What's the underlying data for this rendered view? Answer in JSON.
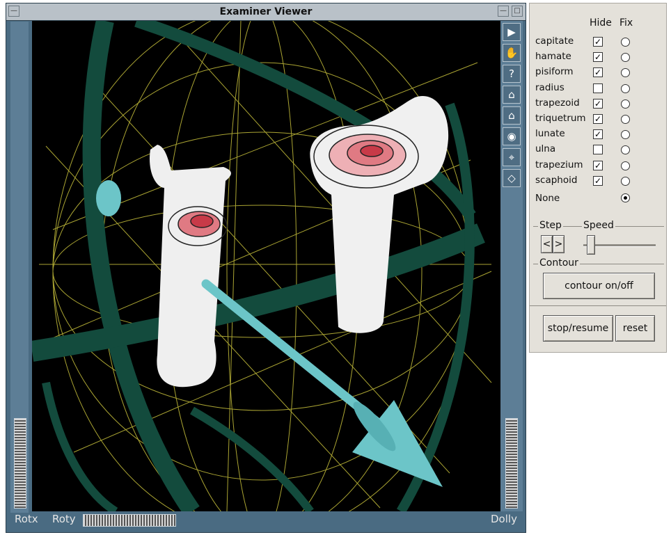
{
  "window": {
    "title": "Examiner Viewer",
    "minimize_glyph": "—",
    "close_glyph": "□"
  },
  "toolbar": {
    "tools": [
      {
        "name": "pick-arrow-icon",
        "glyph": "▶"
      },
      {
        "name": "hand-view-icon",
        "glyph": "✋"
      },
      {
        "name": "help-icon",
        "glyph": "?"
      },
      {
        "name": "home-icon",
        "glyph": "⌂"
      },
      {
        "name": "set-home-icon",
        "glyph": "⌂"
      },
      {
        "name": "view-all-icon",
        "glyph": "◉"
      },
      {
        "name": "seek-icon",
        "glyph": "⌖"
      },
      {
        "name": "perspective-icon",
        "glyph": "◇"
      }
    ]
  },
  "wheels": {
    "rotx": "Rotx",
    "roty": "Roty",
    "dolly": "Dolly"
  },
  "panel": {
    "header_hide": "Hide",
    "header_fix": "Fix",
    "bones": [
      {
        "label": "capitate",
        "hide": true
      },
      {
        "label": "hamate",
        "hide": true
      },
      {
        "label": "pisiform",
        "hide": true
      },
      {
        "label": "radius",
        "hide": false
      },
      {
        "label": "trapezoid",
        "hide": true
      },
      {
        "label": "triquetrum",
        "hide": true
      },
      {
        "label": "lunate",
        "hide": true
      },
      {
        "label": "ulna",
        "hide": false
      },
      {
        "label": "trapezium",
        "hide": true
      },
      {
        "label": "scaphoid",
        "hide": true
      }
    ],
    "none_label": "None",
    "fix_selected": "None",
    "step_label": "Step",
    "step_prev": "<",
    "step_next": ">",
    "speed_label": "Speed",
    "speed_value": 0.05,
    "contour_label": "Contour",
    "contour_button": "contour on/off",
    "stop_resume_button": "stop/resume",
    "reset_button": "reset"
  },
  "colors": {
    "viewer_frame": "#4a6b82",
    "scene_background": "#000000",
    "ring_green": "#134b3d",
    "wire_yellow": "#c9c23c",
    "arrow_cyan": "#6cc5c8",
    "bone_white": "#f2f2f2",
    "contour_red": "#d8505a",
    "panel_bg": "#e4e1da"
  }
}
